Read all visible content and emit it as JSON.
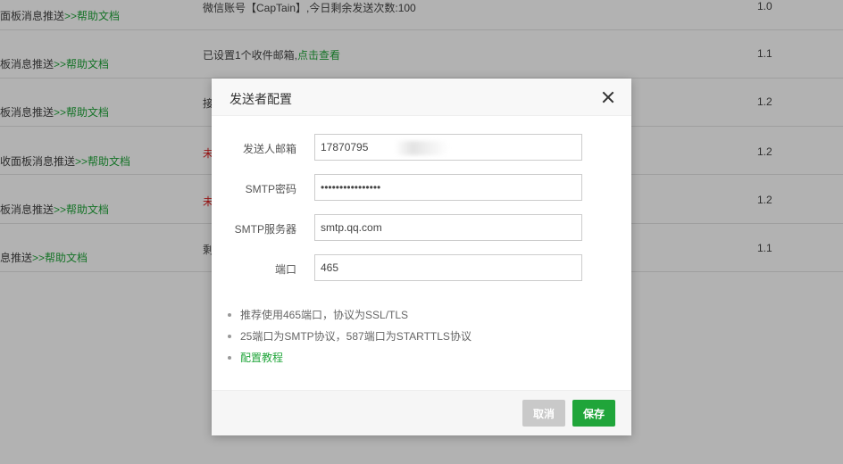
{
  "background_rows": [
    {
      "name": "面板消息推送",
      "help": ">>帮助文档",
      "desc": "微信账号【CapTain】,今日剩余发送次数:100",
      "desc_link": "",
      "version": "1.0"
    },
    {
      "name": "板消息推送",
      "help": ">>帮助文档",
      "desc": "已设置1个收件邮箱,",
      "desc_link": "点击查看",
      "version": "1.1"
    },
    {
      "name": "板消息推送",
      "help": ">>帮助文档",
      "desc": "接",
      "desc_link": "",
      "version": "1.2"
    },
    {
      "name": "收面板消息推送",
      "help": ">>帮助文档",
      "desc": "未",
      "desc_link": "",
      "version": "1.2"
    },
    {
      "name": "板消息推送",
      "help": ">>帮助文档",
      "desc": "未",
      "desc_link": "",
      "version": "1.2"
    },
    {
      "name": "息推送",
      "help": ">>帮助文档",
      "desc": "剩",
      "desc_link": "",
      "version": "1.1"
    }
  ],
  "dialog": {
    "title": "发送者配置",
    "fields": {
      "sender_label": "发送人邮箱",
      "sender_value": "17870795",
      "password_label": "SMTP密码",
      "password_value": "••••••••••••••••",
      "server_label": "SMTP服务器",
      "server_value": "smtp.qq.com",
      "port_label": "端口",
      "port_value": "465"
    },
    "tips": [
      "推荐使用465端口，协议为SSL/TLS",
      "25端口为SMTP协议，587端口为STARTTLS协议"
    ],
    "tutorial_link": "配置教程",
    "cancel_label": "取消",
    "save_label": "保存"
  },
  "colors": {
    "accent": "#20a53a",
    "danger": "#e02020",
    "button_disabled": "#c9c9c9"
  }
}
